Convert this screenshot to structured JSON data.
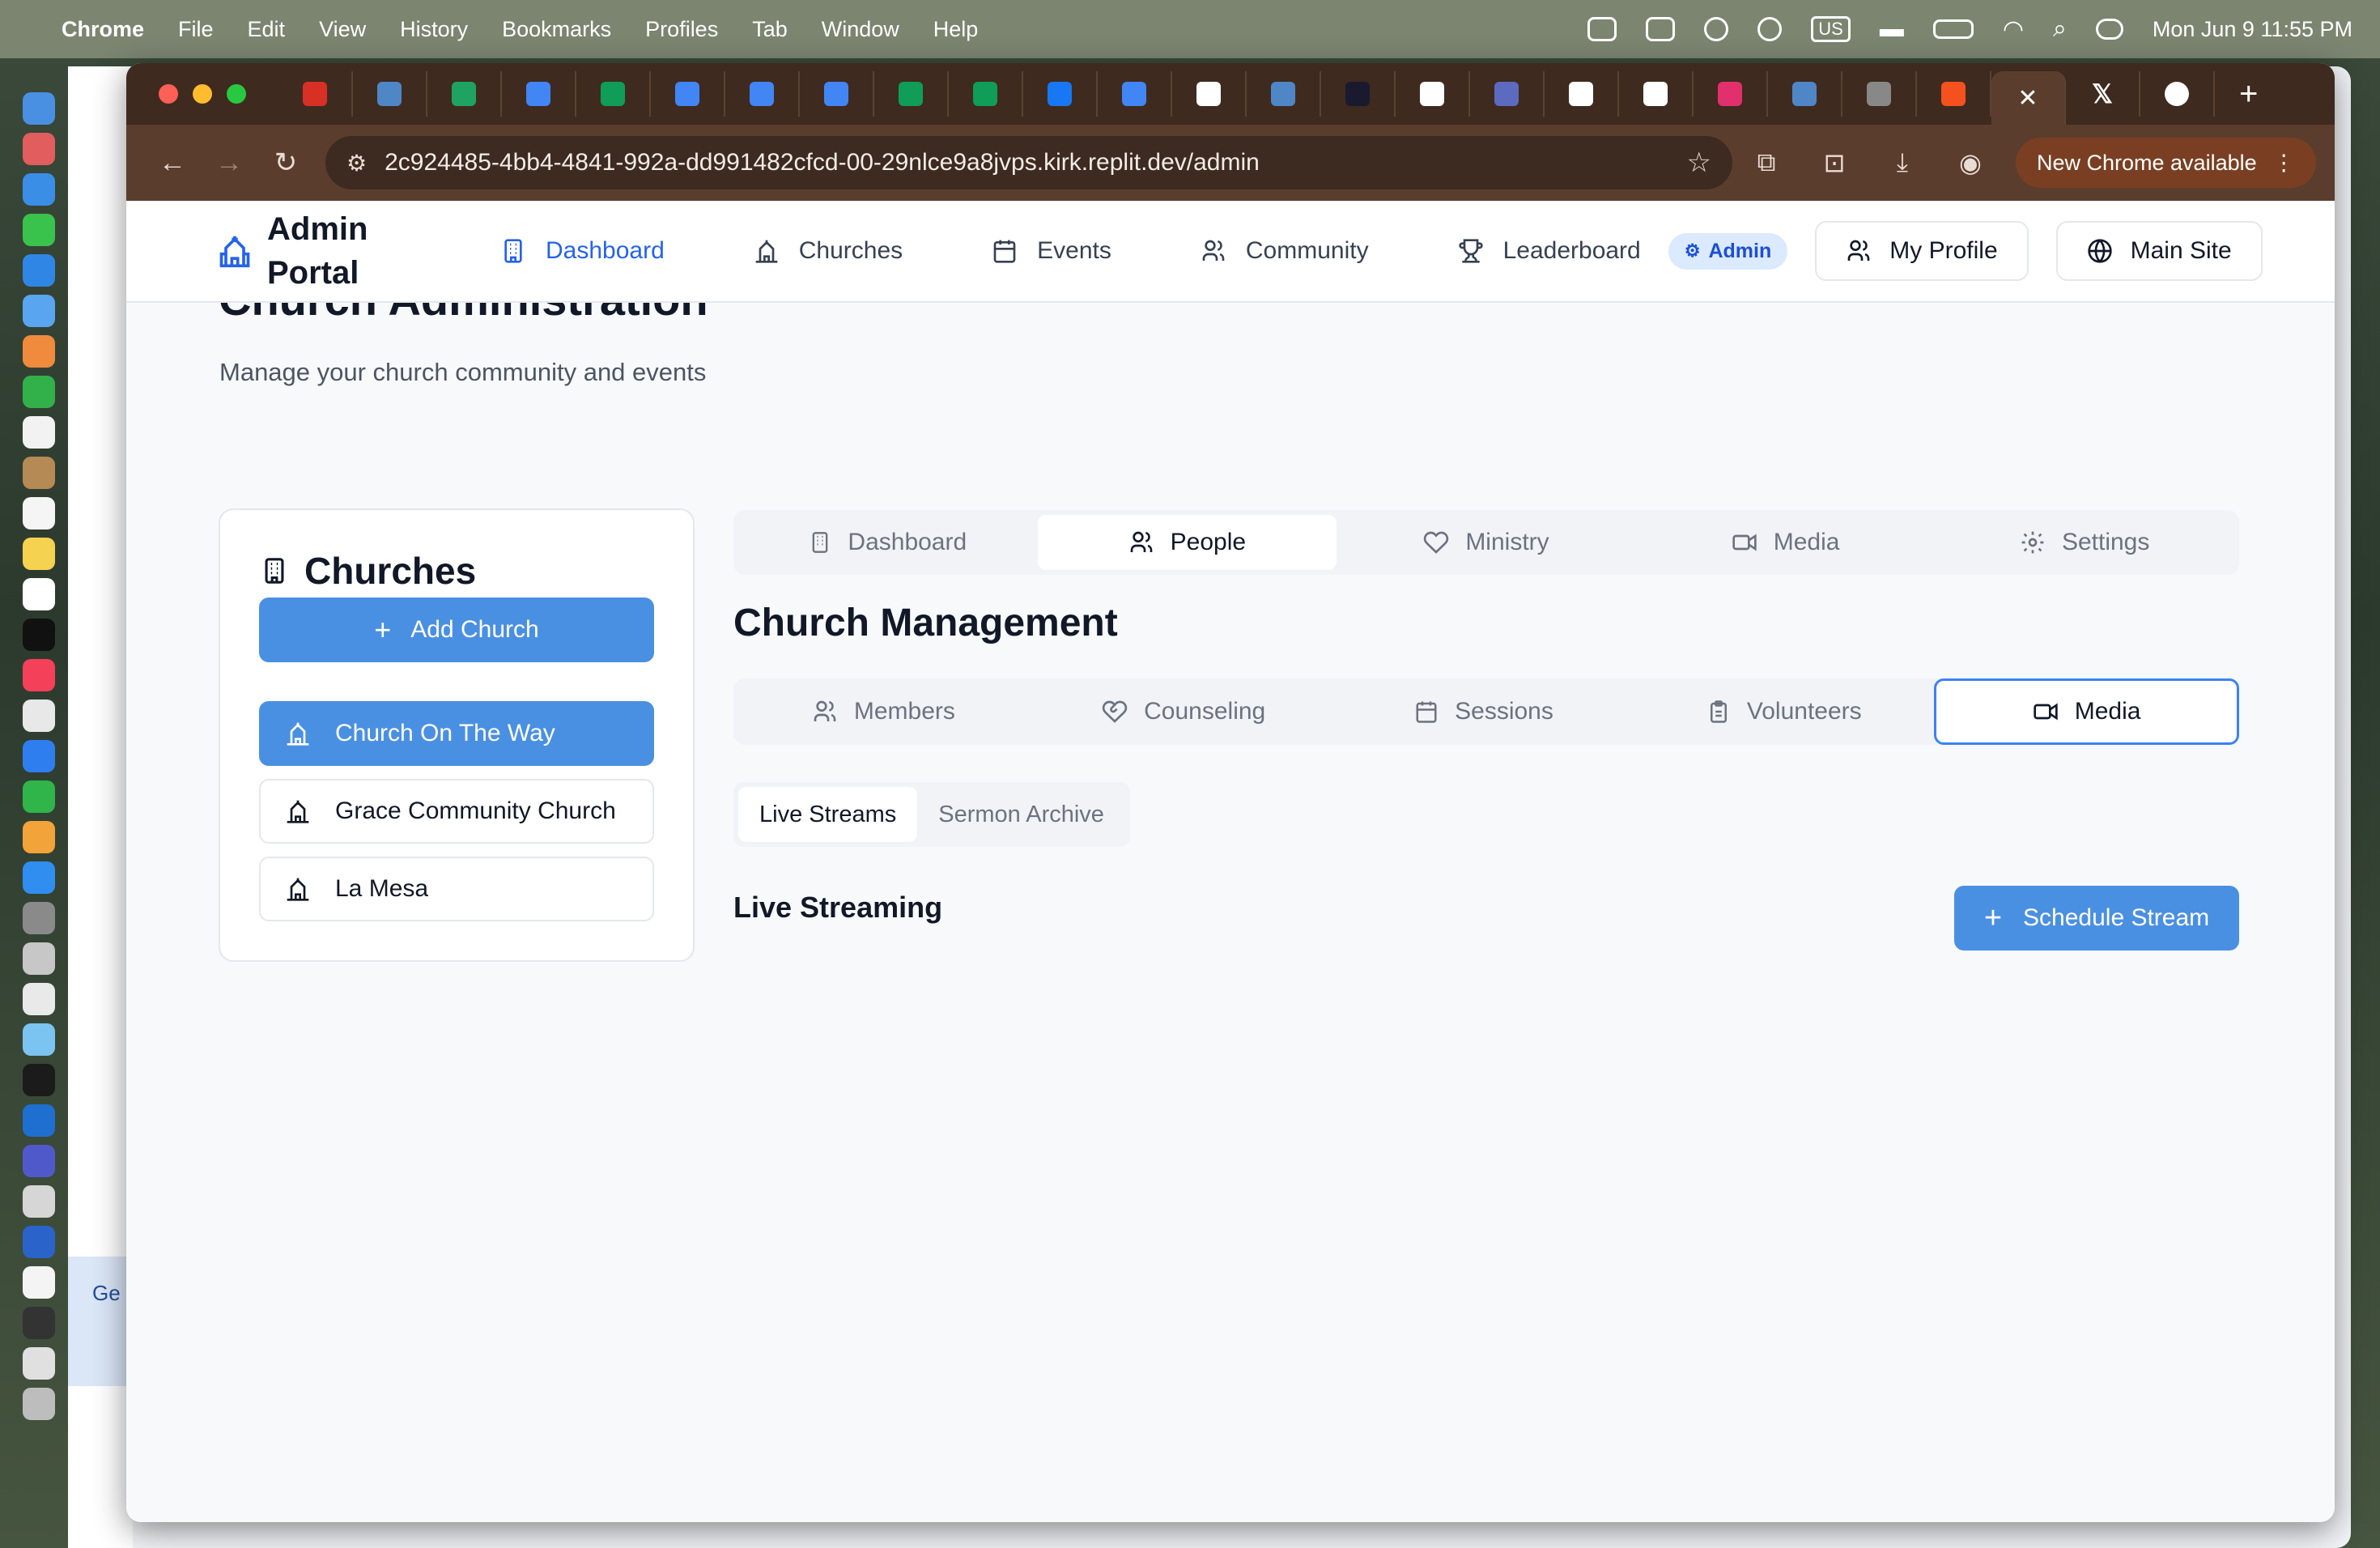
{
  "menubar": {
    "app": "Chrome",
    "items": [
      "File",
      "Edit",
      "View",
      "History",
      "Bookmarks",
      "Profiles",
      "Tab",
      "Window",
      "Help"
    ],
    "status_input": "US",
    "clock": "Mon Jun 9  11:55 PM"
  },
  "bg_window": {
    "partial_text": "Ge"
  },
  "browser": {
    "url": "2c924485-4bb4-4841-992a-dd991482cfcd-00-29nlce9a8jvps.kirk.replit.dev/admin",
    "update_label": "New Chrome available",
    "tab_favicon_colors": [
      "#d93025",
      "#4f86c6",
      "#1ea362",
      "#4285f4",
      "#0f9d58",
      "#4285f4",
      "#4285f4",
      "#4285f4",
      "#0f9d58",
      "#0f9d58",
      "#1877f2",
      "#4285f4",
      "#ffffff",
      "#4f86c6",
      "#1a1a2e",
      "#ffffff",
      "#5c6bc0",
      "#ffffff",
      "#ffffff",
      "#e1306c",
      "#4f86c6",
      "#888888",
      "#f4511e"
    ]
  },
  "header": {
    "brand_line1": "Admin",
    "brand_line2": "Portal",
    "nav": [
      {
        "label": "Dashboard",
        "icon": "building-icon"
      },
      {
        "label": "Churches",
        "icon": "church-icon"
      },
      {
        "label": "Events",
        "icon": "calendar-icon"
      },
      {
        "label": "Community",
        "icon": "users-icon"
      },
      {
        "label": "Leaderboard",
        "icon": "trophy-icon"
      }
    ],
    "admin_badge": "Admin",
    "my_profile": "My Profile",
    "main_site": "Main Site"
  },
  "page": {
    "title": "Church Administration",
    "subtitle": "Manage your church community and events"
  },
  "churches": {
    "heading": "Churches",
    "add_label": "Add Church",
    "items": [
      "Church On The Way",
      "Grace Community Church",
      "La Mesa"
    ],
    "selected": "Church On The Way"
  },
  "main_tabs": {
    "items": [
      "Dashboard",
      "People",
      "Ministry",
      "Media",
      "Settings"
    ],
    "active": "People"
  },
  "section": {
    "title": "Church Management"
  },
  "sub_tabs": {
    "items": [
      "Members",
      "Counseling",
      "Sessions",
      "Volunteers",
      "Media"
    ],
    "active": "Media"
  },
  "media_tabs": {
    "items": [
      "Live Streams",
      "Sermon Archive"
    ],
    "active": "Live Streams"
  },
  "streaming": {
    "title": "Live Streaming",
    "schedule_label": "Schedule Stream"
  },
  "colors": {
    "primary": "#4a90e2",
    "accent_text": "#2563eb",
    "chrome_frame": "#5a3d2d"
  }
}
